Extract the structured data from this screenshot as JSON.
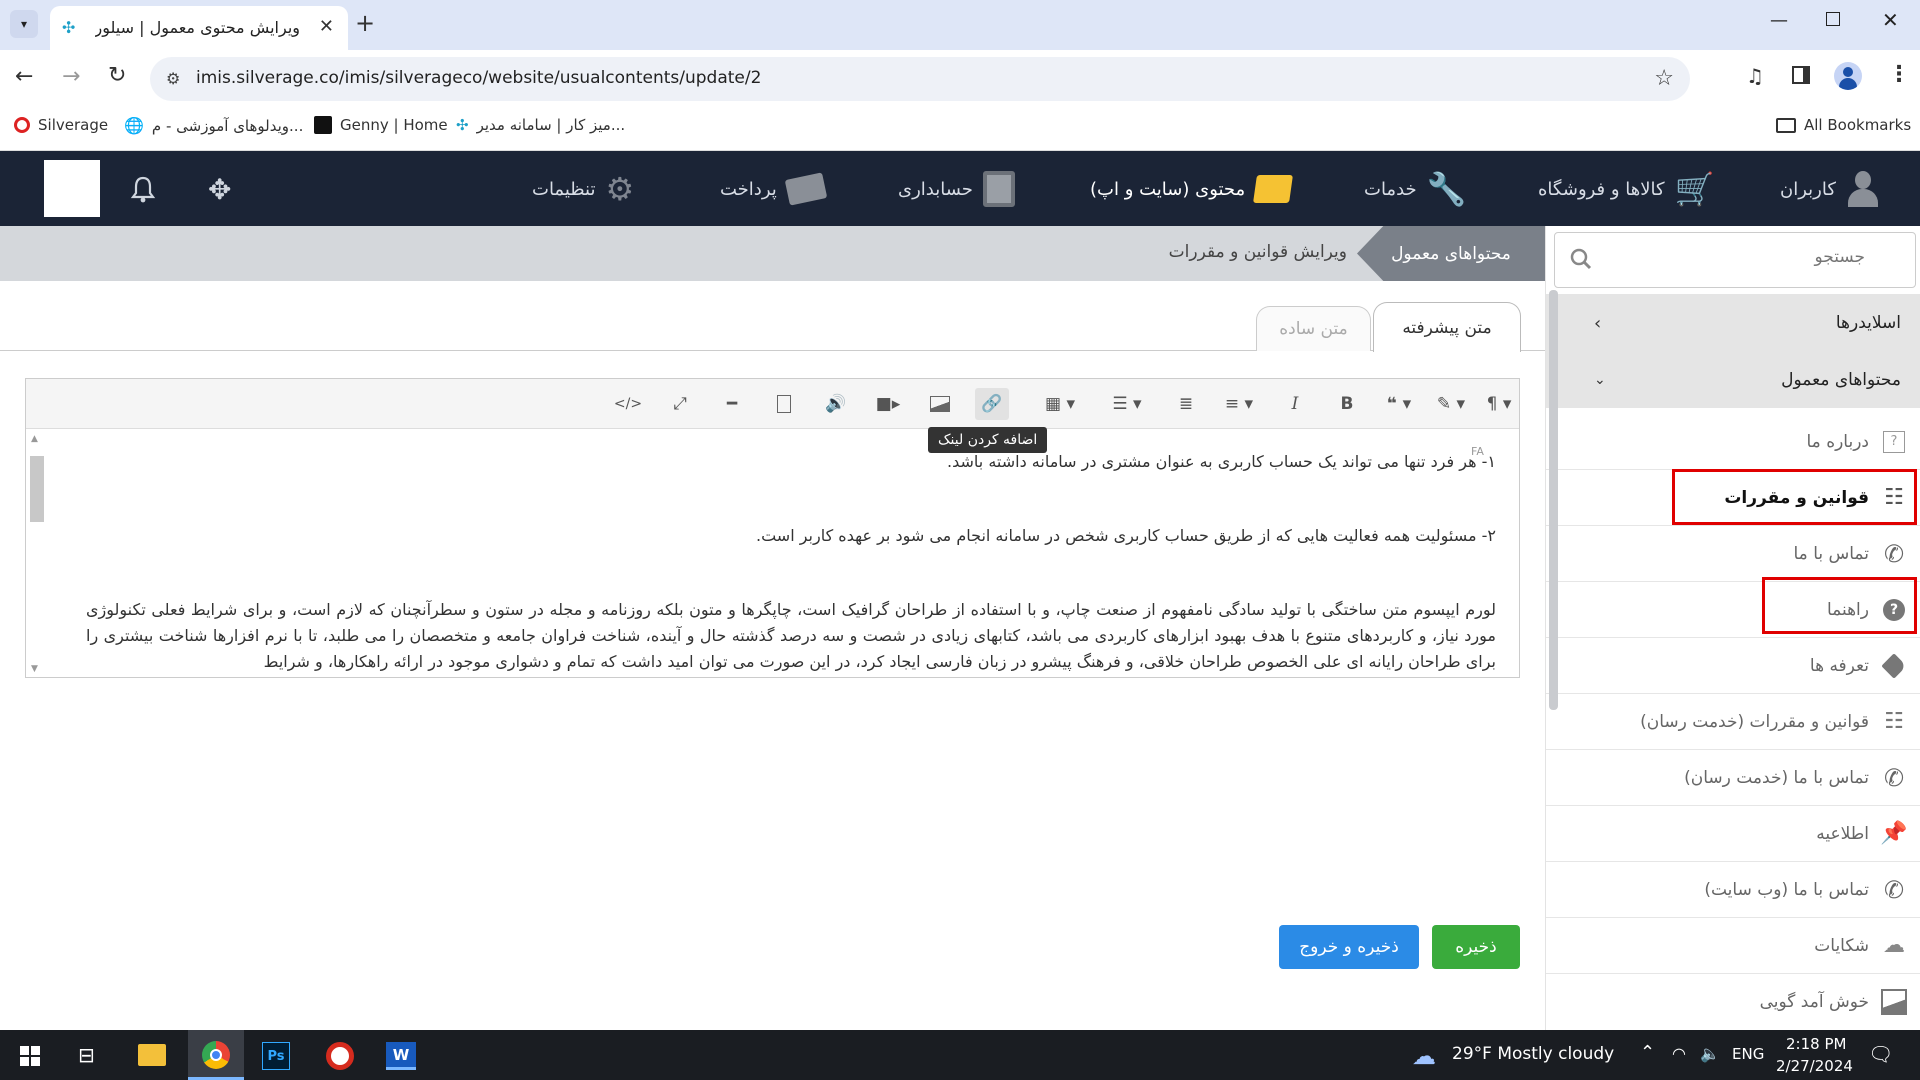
{
  "browser": {
    "tab_title": "ویرایش محتوی معمول | سیلورشاپ",
    "url": "imis.silverage.co/imis/silverageco/website/usualcontents/update/2",
    "bookmarks": [
      {
        "label": "Silverage"
      },
      {
        "label": "ویدلوهای آموزشی - م..."
      },
      {
        "label": "Genny | Home"
      },
      {
        "label": "میز کار | سامانه مدیر..."
      }
    ],
    "all_bookmarks": "All Bookmarks"
  },
  "nav": {
    "items": [
      {
        "label": "کاربران"
      },
      {
        "label": "کالاها و فروشگاه"
      },
      {
        "label": "خدمات"
      },
      {
        "label": "محتوی (سایت و اپ)"
      },
      {
        "label": "حسابداری"
      },
      {
        "label": "پرداخت"
      },
      {
        "label": "تنظیمات"
      }
    ]
  },
  "breadcrumb": {
    "parent": "محتواهای معمول",
    "current": "ویرایش قوانین و مقررات"
  },
  "sidebar": {
    "search_placeholder": "جستجو",
    "sections": [
      {
        "label": "اسلایدرها"
      },
      {
        "label": "محتواهای معمول"
      }
    ],
    "items": [
      {
        "label": "درباره ما",
        "icon": "question-box-icon"
      },
      {
        "label": "قوانین و مقررات",
        "icon": "traffic-light-icon"
      },
      {
        "label": "تماس با ما",
        "icon": "phone-icon"
      },
      {
        "label": "راهنما",
        "icon": "help-circle-icon"
      },
      {
        "label": "تعرفه ها",
        "icon": "tag-icon"
      },
      {
        "label": "قوانین و مقررات (خدمت رسان)",
        "icon": "traffic-light-icon"
      },
      {
        "label": "تماس با ما (خدمت رسان)",
        "icon": "phone-icon"
      },
      {
        "label": "اطلاعیه",
        "icon": "pin-icon"
      },
      {
        "label": "تماس با ما (وب سایت)",
        "icon": "phone-icon"
      },
      {
        "label": "شکایات",
        "icon": "cloud-icon"
      },
      {
        "label": "خوش آمد گویی",
        "icon": "image-icon"
      }
    ]
  },
  "editor": {
    "tabs": {
      "advanced": "متن پیشرفته",
      "plain": "متن ساده"
    },
    "tooltip": "اضافه کردن لینک",
    "lang_badge": "FA",
    "paragraphs": [
      "۱- هر فرد تنها می تواند یک حساب کاربری به عنوان مشتری در سامانه داشته باشد.",
      "۲- مسئولیت همه فعالیت هایی که از طریق حساب کاربری شخص در سامانه انجام می شود بر عهده کاربر است.",
      "لورم ایپسوم متن ساختگی با تولید سادگی نامفهوم از صنعت چاپ، و با استفاده از طراحان گرافیک است، چاپگرها و متون بلکه روزنامه و مجله در ستون و سطرآنچنان که لازم است، و برای شرایط فعلی تکنولوژی مورد نیاز، و کاربردهای متنوع با هدف بهبود ابزارهای کاربردی می باشد، کتابهای زیادی در شصت و سه درصد گذشته حال و آینده، شناخت فراوان جامعه و متخصصان را می طلبد، تا با نرم افزارها شناخت بیشتری را برای طراحان رایانه ای علی الخصوص طراحان خلاقی، و فرهنگ پیشرو در زبان فارسی ایجاد کرد، در این صورت می توان امید داشت که تمام و دشواری موجود در ارائه راهکارها، و شرایط"
    ]
  },
  "buttons": {
    "save": "ذخیره",
    "save_exit": "ذخیره و خروج"
  },
  "taskbar": {
    "weather": "29°F  Mostly cloudy",
    "lang": "ENG",
    "time": "2:18 PM",
    "date": "2/27/2024"
  },
  "colors": {
    "nav_bg": "#1b2436",
    "save_green": "#3aab3c",
    "save_exit_blue": "#2b8be6",
    "highlight_red": "#e00000"
  }
}
